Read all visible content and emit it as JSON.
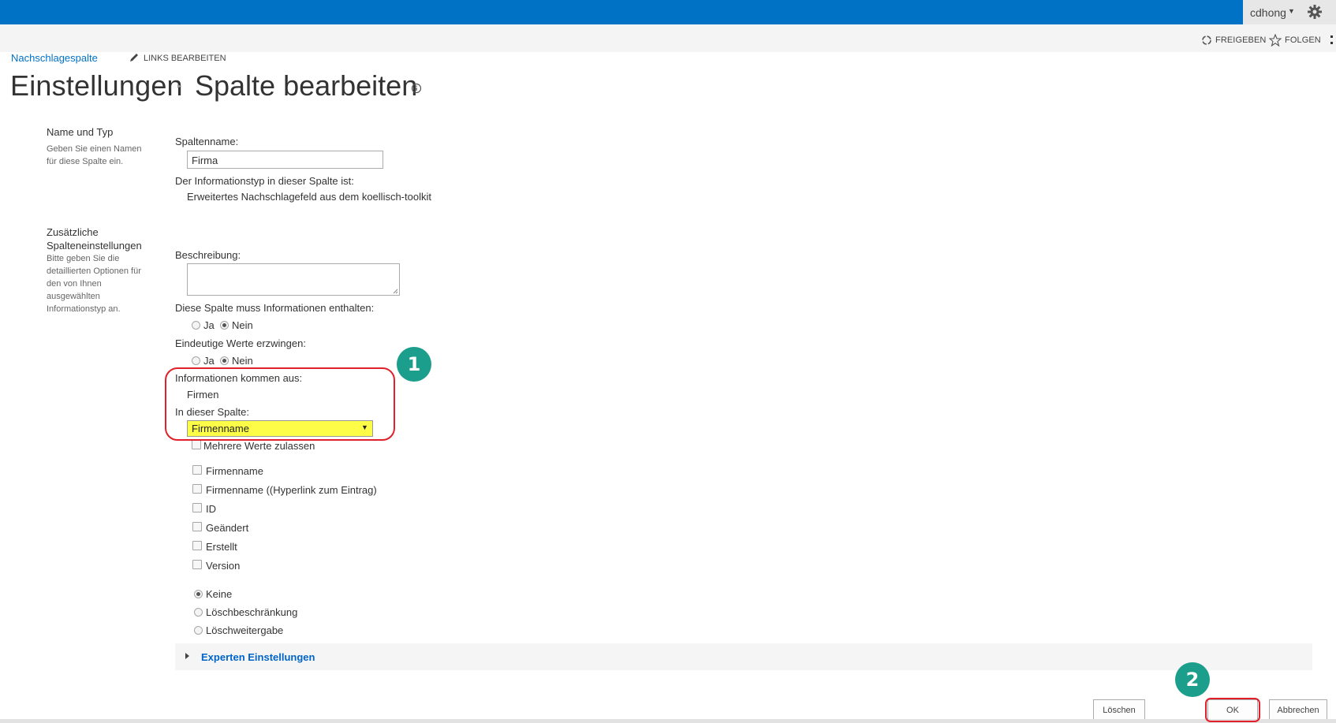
{
  "colors": {
    "brand": "#0072c6",
    "link": "#0072c6",
    "highlight": "#fdfd48",
    "marker": "#1b9e8c",
    "annotation": "#e0202a"
  },
  "header": {
    "user": "cdhong"
  },
  "actions": {
    "share": "FREIGEBEN",
    "follow": "FOLGEN"
  },
  "breadcrumb": {
    "link": "Nachschlagespalte",
    "edit_links": "LINKS BEARBEITEN"
  },
  "title": {
    "part1": "Einstellungen",
    "separator": "▸",
    "part2": "Spalte bearbeiten"
  },
  "section1": {
    "title": "Name und Typ",
    "desc_line1": "Geben Sie einen Namen",
    "desc_line2": "für diese Spalte ein."
  },
  "section2": {
    "title_line1": "Zusätzliche",
    "title_line2": "Spalteneinstellungen",
    "desc_line1": "Bitte geben Sie die",
    "desc_line2": "detaillierten Optionen für",
    "desc_line3": "den von Ihnen",
    "desc_line4": "ausgewählten",
    "desc_line5": "Informationstyp an."
  },
  "form": {
    "column_name_label": "Spaltenname:",
    "column_name_value": "Firma",
    "type_label": "Der Informationstyp in dieser Spalte ist:",
    "type_value": "Erweitertes Nachschlagefeld aus dem koellisch-toolkit",
    "description_label": "Beschreibung:",
    "required_label": "Diese Spalte muss Informationen enthalten:",
    "unique_label": "Eindeutige Werte erzwingen:",
    "yes": "Ja",
    "no": "Nein",
    "required_value": "Nein",
    "unique_value": "Nein",
    "source_label": "Informationen kommen aus:",
    "source_value": "Firmen",
    "in_column_label": "In dieser Spalte:",
    "in_column_value": "Firmenname",
    "multi_label": "Mehrere Werte zulassen",
    "additional_fields": [
      "Firmenname",
      "Firmenname ((Hyperlink zum Eintrag)",
      "ID",
      "Geändert",
      "Erstellt",
      "Version"
    ],
    "relationship_options": [
      "Keine",
      "Löschbeschränkung",
      "Löschweitergabe"
    ],
    "relationship_selected": "Keine"
  },
  "expert": {
    "label": "Experten Einstellungen"
  },
  "buttons": {
    "delete": "Löschen",
    "ok": "OK",
    "cancel": "Abbrechen"
  },
  "annotations": {
    "marker1": "1",
    "marker2": "2"
  }
}
